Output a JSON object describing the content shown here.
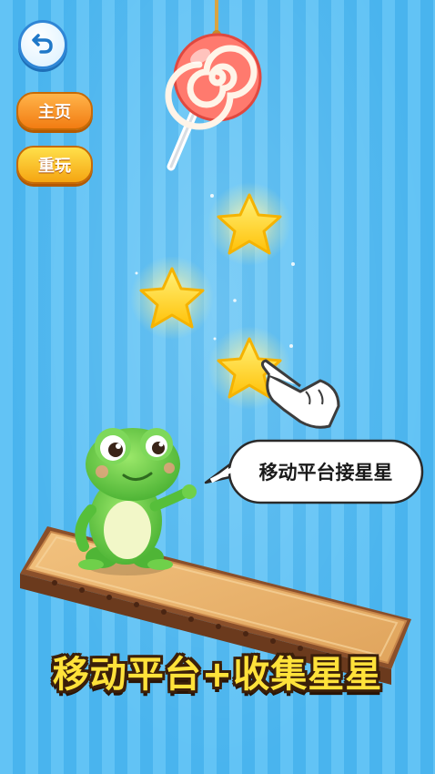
{
  "toolbar": {
    "back_icon": "undo-arrow-icon",
    "home_label": "主页",
    "replay_label": "重玩"
  },
  "speech_bubble": {
    "text": "移动平台接星星"
  },
  "caption": {
    "text": "移动平台+收集星星"
  },
  "scene": {
    "items": [
      "lollipop-icon",
      "star-icon",
      "star-icon",
      "star-icon",
      "frog-character",
      "platform",
      "pointing-hand-icon"
    ],
    "colors": {
      "background": "#62c3f5",
      "star": "#ffd21f",
      "frog": "#6fd04a",
      "platform": "#e8b36c",
      "caption": "#ffe23a"
    }
  }
}
